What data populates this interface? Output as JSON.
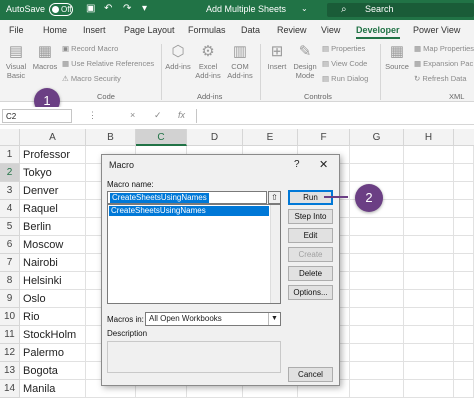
{
  "titlebar": {
    "autosave_label": "AutoSave",
    "autosave_state": "Off",
    "doc_title": "Add Multiple Sheets",
    "search_placeholder": "Search",
    "accent": "#217346"
  },
  "tabs": [
    "File",
    "Home",
    "Insert",
    "Page Layout",
    "Formulas",
    "Data",
    "Review",
    "View",
    "Developer",
    "Power View"
  ],
  "ribbon": {
    "code": {
      "visual_basic": "Visual Basic",
      "macros": "Macros",
      "record_macro": "Record Macro",
      "relative_refs": "Use Relative References",
      "macro_security": "Macro Security",
      "label": "Code"
    },
    "addins": {
      "addins": "Add-ins",
      "excel_addins": "Excel Add-ins",
      "com_addins": "COM Add-ins",
      "label": "Add-ins"
    },
    "controls": {
      "insert": "Insert",
      "design_mode": "Design Mode",
      "properties": "Properties",
      "view_code": "View Code",
      "run_dialog": "Run Dialog",
      "label": "Controls"
    },
    "xml": {
      "source": "Source",
      "map_properties": "Map Properties",
      "expansion_packs": "Expansion Pac",
      "refresh_data": "Refresh Data",
      "label": "XML"
    }
  },
  "annotations": {
    "step1": "1",
    "step2": "2",
    "badge_color": "#6b3f84"
  },
  "formula_bar": {
    "name_box": "C2",
    "cancel": "×",
    "enter": "✓",
    "fx": "fx",
    "formula": ""
  },
  "columns": [
    "A",
    "B",
    "C",
    "D",
    "E",
    "F",
    "G",
    "H"
  ],
  "rows": [
    "1",
    "2",
    "3",
    "4",
    "5",
    "6",
    "7",
    "8",
    "9",
    "10",
    "11",
    "12",
    "13",
    "14"
  ],
  "column_a": [
    "Professor",
    "Tokyo",
    "Denver",
    "Raquel",
    "Berlin",
    "Moscow",
    "Nairobi",
    "Helsinki",
    "Oslo",
    "Rio",
    "StockHolm",
    "Palermo",
    "Bogota",
    "Manila"
  ],
  "dialog": {
    "title": "Macro",
    "help": "?",
    "close": "✕",
    "macro_name_label": "Macro name:",
    "macro_name_value": "CreateSheetsUsingNames",
    "macro_list": [
      "CreateSheetsUsingNames"
    ],
    "macros_in_label": "Macros in:",
    "macros_in_value": "All Open Workbooks",
    "description_label": "Description",
    "buttons": {
      "run": "Run",
      "step_into": "Step Into",
      "edit": "Edit",
      "create": "Create",
      "delete": "Delete",
      "options": "Options...",
      "cancel": "Cancel"
    }
  }
}
